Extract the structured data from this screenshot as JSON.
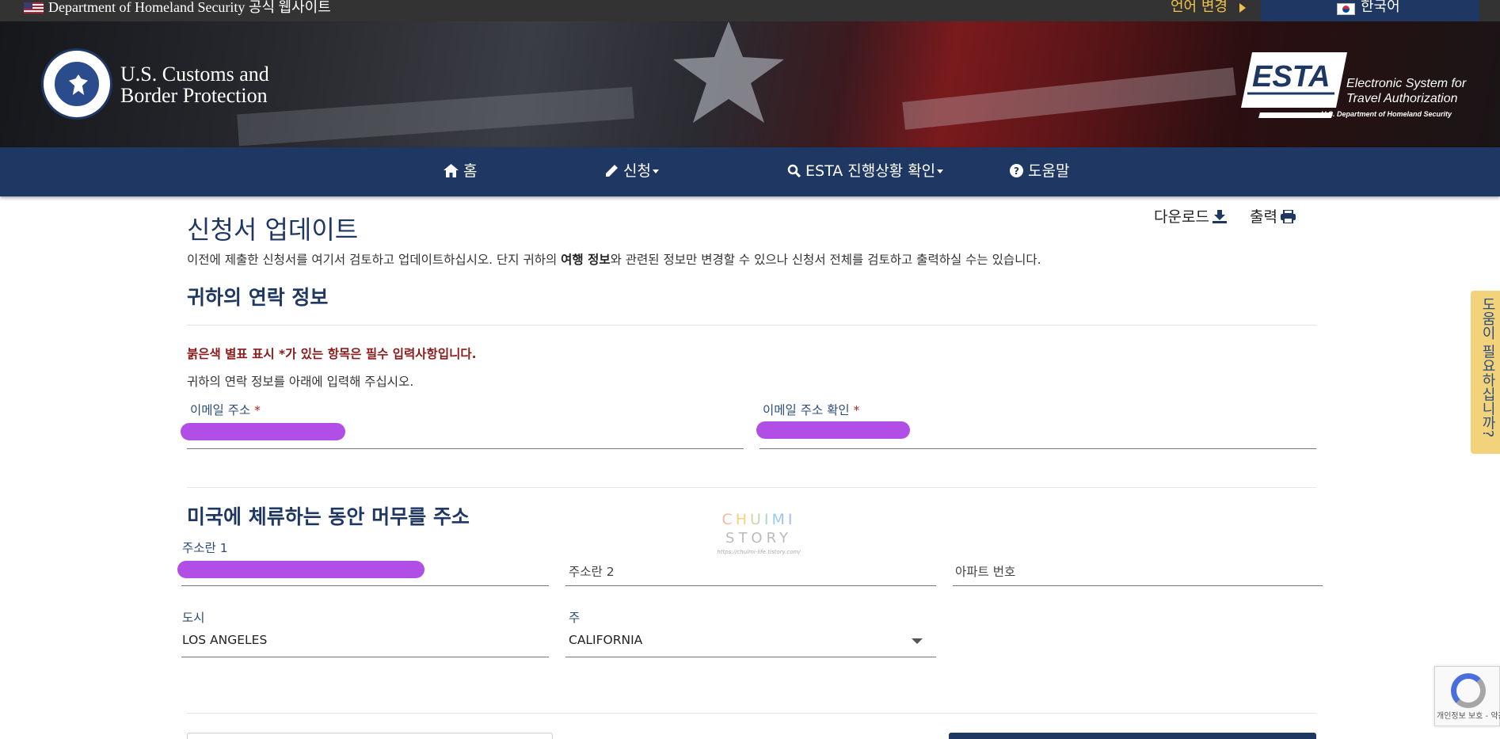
{
  "topbar": {
    "site_label": "Department of Homeland Security 공식 웹사이트",
    "language_change": "언어 변경",
    "language_current": "한국어"
  },
  "banner": {
    "agency_line1": "U.S. Customs and",
    "agency_line2": "Border Protection",
    "esta_logo": "ESTA",
    "esta_tagline1": "Electronic System for",
    "esta_tagline2": "Travel Authorization",
    "esta_sub": "U.S. Department of Homeland Security"
  },
  "nav": {
    "home": "홈",
    "apply": "신청",
    "status": "ESTA 진행상황 확인",
    "help": "도움말"
  },
  "page": {
    "title": "신청서 업데이트",
    "download": "다운로드",
    "print": "출력",
    "intro_pre": "이전에 제출한 신청서를 여기서 검토하고 업데이트하십시오. 단지 귀하의 ",
    "intro_bold": "여행 정보",
    "intro_post": "와 관련된 정보만 변경할 수 있으나 신청서 전체를 검토하고 출력하실 수는 있습니다."
  },
  "contact": {
    "section_title": "귀하의 연락 정보",
    "required_note": "붉은색 별표 표시 *가 있는 항목은 필수 입력사항입니다.",
    "instruction": "귀하의 연락 정보를 아래에 입력해 주십시오.",
    "email_label": "이메일 주소",
    "email_confirm_label": "이메일 주소 확인",
    "required_mark": "*"
  },
  "address": {
    "section_title": "미국에 체류하는 동안 머무를 주소",
    "address1_label": "주소란 1",
    "address2_placeholder": "주소란 2",
    "apt_placeholder": "아파트 번호",
    "city_label": "도시",
    "city_value": "LOS ANGELES",
    "state_label": "주",
    "state_value": "CALIFORNIA"
  },
  "watermark": {
    "line1": "CHUIMI",
    "line2": "STORY",
    "url": "https://chuimi-life.tistory.com/"
  },
  "help_tab": "도움이 필요하십니까?",
  "recaptcha": {
    "text": "개인정보 보호 - 약관"
  },
  "colors": {
    "navy": "#1f3763",
    "gold": "#f0c24a",
    "required_red": "#8b1a1a",
    "redaction": "#b04ee6"
  }
}
